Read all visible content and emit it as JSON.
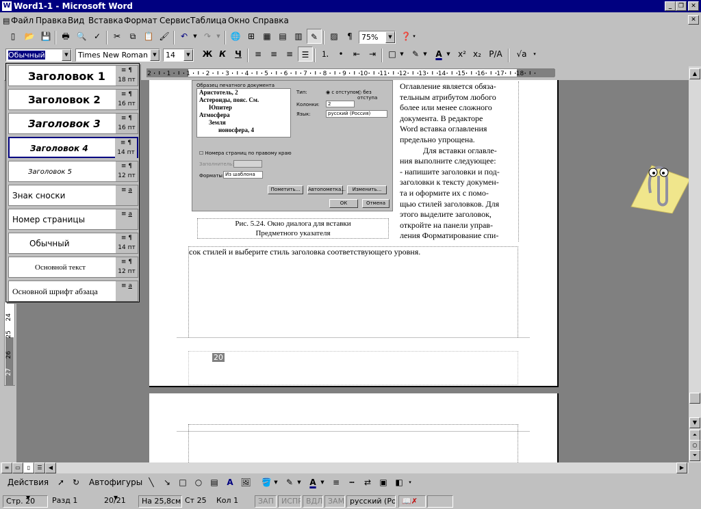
{
  "window": {
    "title": "Word1-1 - Microsoft Word",
    "icon": "word-app-icon"
  },
  "menu": [
    "Файл",
    "Правка",
    "Вид",
    "Вставка",
    "Формат",
    "Сервис",
    "Таблица",
    "Окно",
    "Справка"
  ],
  "standard_toolbar": {
    "zoom": "75%"
  },
  "formatting_toolbar": {
    "style": "Обычный",
    "font": "Times New Roman",
    "size": "14",
    "bold": "Ж",
    "italic": "К",
    "underline": "Ч",
    "pa": "P/A"
  },
  "ruler": {
    "labels": [
      "2",
      "1",
      "1",
      "2",
      "3",
      "4",
      "5",
      "6",
      "7",
      "8",
      "9",
      "10",
      "11",
      "12",
      "13",
      "14",
      "15",
      "16",
      "17",
      "18"
    ]
  },
  "vertical_ruler": {
    "labels": [
      "24",
      "25",
      "26",
      "27"
    ]
  },
  "style_list": [
    {
      "name": "Заголовок 1",
      "size": "18 пт",
      "mark": "¶"
    },
    {
      "name": "Заголовок 2",
      "size": "16 пт",
      "mark": "¶"
    },
    {
      "name": "Заголовок 3",
      "size": "16 пт",
      "mark": "¶"
    },
    {
      "name": "Заголовок 4",
      "size": "14 пт",
      "mark": "¶"
    },
    {
      "name": "Заголовок 5",
      "size": "12 пт",
      "mark": "¶"
    },
    {
      "name": "Знак сноски",
      "size": "",
      "mark": "a"
    },
    {
      "name": "Номер страницы",
      "size": "",
      "mark": "a"
    },
    {
      "name": "Обычный",
      "size": "14 пт",
      "mark": "¶"
    },
    {
      "name": "Основной текст",
      "size": "12 пт",
      "mark": "¶"
    },
    {
      "name": "Основной шрифт абзаца",
      "size": "",
      "mark": "a"
    }
  ],
  "figure": {
    "caption_line1": "Рис. 5.24. Окно диалога для вставки",
    "caption_line2": "Предметного указателя",
    "dialog": {
      "sample_label": "Образец печатного документа",
      "sample_lines": [
        "Аристотель, 2",
        "Астероиды, пояс. См.",
        "Юпитер",
        "Атмосфера",
        "Земля",
        "ионосфера, 4"
      ],
      "type_label": "Тип:",
      "radio1": "с отступом",
      "radio2": "без отступа",
      "columns_label": "Колонки:",
      "columns_value": "2",
      "lang_label": "Язык:",
      "lang_value": "русский (Россия)",
      "align_checkbox": "Номера страниц по правому краю",
      "filler_label": "Заполнитель:",
      "formats_label": "Форматы:",
      "formats_value": "Из шаблона",
      "btn_mark": "Пометить...",
      "btn_auto": "Автопометка...",
      "btn_change": "Изменить...",
      "btn_ok": "ОК",
      "btn_cancel": "Отмена"
    }
  },
  "body_text": {
    "col_lines": [
      "Оглавление является обяза-",
      "тельным атрибутом любого",
      "более или менее сложного",
      "документа. В редакторе",
      "Word вставка оглавления",
      "предельно упрощена.",
      "Для вставки оглавле-",
      "ния выполните следующее:",
      "- напишите заголовки и под-",
      "заголовки к тексту докумен-",
      "та и оформите их с помо-",
      "щью стилей заголовков. Для",
      "этого выделите заголовок,",
      "откройте на панели управ-",
      "ления Форматирование спи-"
    ],
    "full_line": "сок стилей и выберите стиль заголовка соответствующего уровня.",
    "page_number": "20"
  },
  "drawing_toolbar": {
    "actions": "Действия",
    "autoshapes": "Автофигуры"
  },
  "status": {
    "page": "Стр. 20",
    "section": "Разд 1",
    "pages": "20/21",
    "at": "На 25,8см",
    "line": "Ст 25",
    "col": "Кол 1",
    "rec": "ЗАП",
    "trk": "ИСПР",
    "ext": "ВДЛ",
    "ovr": "ЗАМ",
    "lang": "русский (Ро"
  },
  "colors": {
    "title_bg": "#000080",
    "face": "#c0c0c0",
    "workspace": "#808080"
  }
}
